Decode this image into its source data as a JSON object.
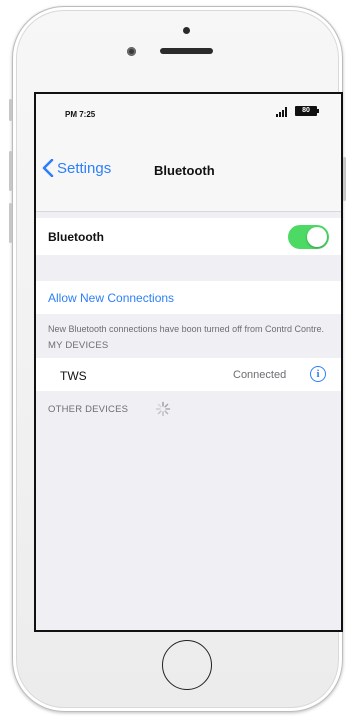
{
  "status_bar": {
    "time": "PM 7:25",
    "battery": "80"
  },
  "nav": {
    "back_label": "Settings",
    "title": "Bluetooth"
  },
  "bluetooth_cell": {
    "label": "Bluetooth",
    "enabled": true
  },
  "allow_cell": {
    "label": "Allow New Connections"
  },
  "footnote": "New Bluetooth connections have boon turned off from Contrd Contre.",
  "my_devices": {
    "header": "MY DEVICES",
    "items": [
      {
        "name": "TWS",
        "status": "Connected",
        "icon": "info-icon"
      }
    ]
  },
  "other_devices": {
    "header": "OTHER DEVICES",
    "icon": "loading-spinner-icon"
  },
  "colors": {
    "accent": "#2d7ff9",
    "toggle_on": "#4cd964",
    "background": "#efeff4",
    "secondary_text": "#6d6d72"
  }
}
